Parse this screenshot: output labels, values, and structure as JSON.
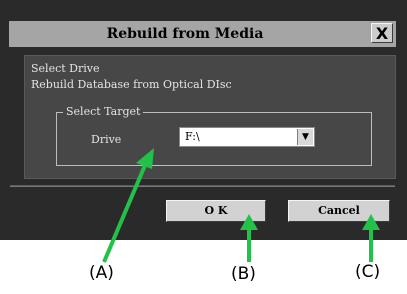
{
  "dialog": {
    "title": "Rebuild from Media",
    "close_label": "X",
    "line1": "Select Drive",
    "line2": "Rebuild Database from Optical DIsc",
    "group": {
      "legend": "Select Target",
      "drive_label": "Drive",
      "drive_value": "F:\\"
    },
    "buttons": {
      "ok": "O K",
      "cancel": "Cancel"
    }
  },
  "callouts": {
    "a": "(A)",
    "b": "(B)",
    "c": "(C)",
    "color": "#22c24a"
  }
}
